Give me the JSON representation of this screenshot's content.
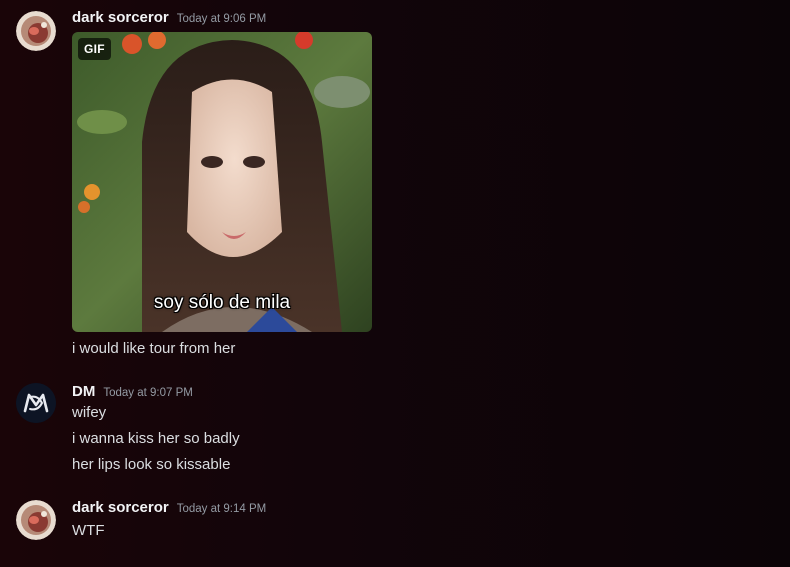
{
  "messages": [
    {
      "username": "dark sorceror",
      "timestamp": "Today at 9:06 PM",
      "avatar_icon": "sushi-roll-avatar",
      "gif": {
        "badge": "GIF",
        "caption": "soy sólo de mila"
      },
      "lines": [
        "i would like tour from her"
      ]
    },
    {
      "username": "DM",
      "timestamp": "Today at 9:07 PM",
      "avatar_icon": "dm-monogram-avatar",
      "lines": [
        "wifey",
        "i wanna kiss her so badly",
        "her lips look so kissable"
      ]
    },
    {
      "username": "dark sorceror",
      "timestamp": "Today at 9:14 PM",
      "avatar_icon": "sushi-roll-avatar",
      "lines": [
        "WTF"
      ]
    }
  ],
  "colors": {
    "background": "#12050a",
    "username": "#f2f3f5",
    "text": "#dbdee1",
    "timestamp": "#949ba4",
    "dm_avatar_bg": "#0d1424"
  }
}
